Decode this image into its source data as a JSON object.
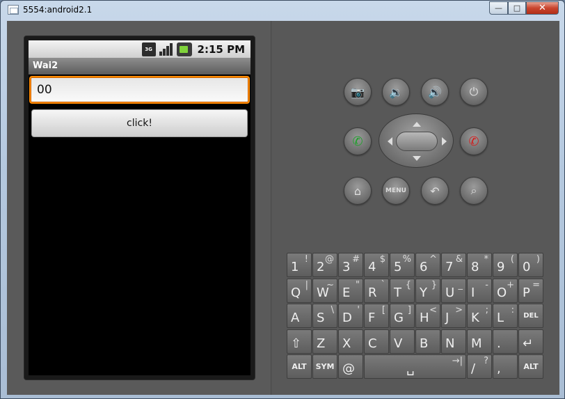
{
  "window": {
    "title": "5554:android2.1",
    "min_glyph": "—",
    "max_glyph": "□",
    "close_glyph": "✕"
  },
  "device": {
    "status": {
      "network": "3G",
      "time": "2:15 PM"
    },
    "app_title": "Wai2",
    "edit_value": "00",
    "button_label": "click!"
  },
  "controls": {
    "menu_label": "MENU",
    "icons": {
      "camera": "📷",
      "vol_down": "🔉",
      "vol_up": "🔊",
      "power": "⏻",
      "call": "✆",
      "end_call": "✆",
      "home": "⌂",
      "back": "↶",
      "search": "⌕"
    }
  },
  "keyboard": {
    "rows": [
      [
        {
          "m": "1",
          "a": "!"
        },
        {
          "m": "2",
          "a": "@"
        },
        {
          "m": "3",
          "a": "#"
        },
        {
          "m": "4",
          "a": "$"
        },
        {
          "m": "5",
          "a": "%"
        },
        {
          "m": "6",
          "a": "^"
        },
        {
          "m": "7",
          "a": "&"
        },
        {
          "m": "8",
          "a": "*"
        },
        {
          "m": "9",
          "a": "("
        },
        {
          "m": "0",
          "a": ")"
        }
      ],
      [
        {
          "m": "Q",
          "a": "|"
        },
        {
          "m": "W",
          "a": "~"
        },
        {
          "m": "E",
          "a": "\""
        },
        {
          "m": "R",
          "a": "`"
        },
        {
          "m": "T",
          "a": "{"
        },
        {
          "m": "Y",
          "a": "}"
        },
        {
          "m": "U",
          "a": "_"
        },
        {
          "m": "I",
          "a": "-"
        },
        {
          "m": "O",
          "a": "+"
        },
        {
          "m": "P",
          "a": "="
        }
      ],
      [
        {
          "m": "A",
          "a": ""
        },
        {
          "m": "S",
          "a": "\\"
        },
        {
          "m": "D",
          "a": "'"
        },
        {
          "m": "F",
          "a": "["
        },
        {
          "m": "G",
          "a": "]"
        },
        {
          "m": "H",
          "a": "<"
        },
        {
          "m": "J",
          "a": ">"
        },
        {
          "m": "K",
          "a": ";"
        },
        {
          "m": "L",
          "a": ":"
        },
        {
          "m": "DEL",
          "a": ""
        }
      ],
      [
        {
          "m": "⇧",
          "a": ""
        },
        {
          "m": "Z",
          "a": ""
        },
        {
          "m": "X",
          "a": ""
        },
        {
          "m": "C",
          "a": ""
        },
        {
          "m": "V",
          "a": ""
        },
        {
          "m": "B",
          "a": ""
        },
        {
          "m": "N",
          "a": ""
        },
        {
          "m": "M",
          "a": ""
        },
        {
          "m": ".",
          "a": ""
        },
        {
          "m": "↵",
          "a": ""
        }
      ]
    ],
    "bottom": {
      "alt": "ALT",
      "sym": "SYM",
      "at": "@",
      "space": "␣",
      "tab": "→|",
      "slash": "/",
      "slash_alt": "?",
      "comma": ",",
      "alt2": "ALT"
    }
  }
}
